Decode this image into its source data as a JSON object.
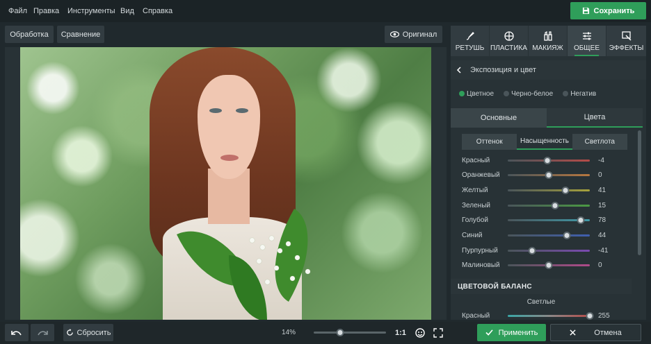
{
  "menu": [
    "Файл",
    "Правка",
    "Инструменты",
    "Вид",
    "Справка"
  ],
  "save_label": "Сохранить",
  "toolbar": {
    "processing": "Обработка",
    "compare": "Сравнение",
    "original": "Оригинал"
  },
  "tabs": [
    {
      "label": "РЕТУШЬ",
      "icon": "brush-icon",
      "active": false
    },
    {
      "label": "ПЛАСТИКА",
      "icon": "crosshair-icon",
      "active": false
    },
    {
      "label": "МАКИЯЖ",
      "icon": "makeup-icon",
      "active": false
    },
    {
      "label": "ОБЩЕЕ",
      "icon": "sliders-icon",
      "active": true
    },
    {
      "label": "ЭФФЕКТЫ",
      "icon": "magic-wand-icon",
      "active": false
    }
  ],
  "section_title": "Экспозиция и цвет",
  "modes": [
    {
      "label": "Цветное",
      "selected": true
    },
    {
      "label": "Черно-белое",
      "selected": false
    },
    {
      "label": "Негатив",
      "selected": false
    }
  ],
  "subtabs": [
    {
      "label": "Основные",
      "active": false
    },
    {
      "label": "Цвета",
      "active": true
    }
  ],
  "segments": [
    {
      "label": "Оттенок",
      "active": false
    },
    {
      "label": "Насыщенность",
      "active": true
    },
    {
      "label": "Светлота",
      "active": false
    }
  ],
  "sliders": [
    {
      "label": "Красный",
      "value": -4,
      "color": "#b54b48"
    },
    {
      "label": "Оранжевый",
      "value": 0,
      "color": "#b7773f"
    },
    {
      "label": "Желтый",
      "value": 41,
      "color": "#a7a23c"
    },
    {
      "label": "Зеленый",
      "value": 15,
      "color": "#4b9a43"
    },
    {
      "label": "Голубой",
      "value": 78,
      "color": "#3f9aa8"
    },
    {
      "label": "Синий",
      "value": 44,
      "color": "#3f5fb0"
    },
    {
      "label": "Пурпурный",
      "value": -41,
      "color": "#7a4ab0"
    },
    {
      "label": "Малиновый",
      "value": 0,
      "color": "#b04a8a"
    }
  ],
  "color_balance": {
    "title": "ЦВЕТОВОЙ БАЛАНС",
    "subtitle": "Светлые",
    "slider": {
      "label": "Красный",
      "value": 255,
      "color": "#b54b48"
    }
  },
  "bottom": {
    "reset": "Сбросить",
    "zoom": "14%",
    "zoom_level": 0.37,
    "one_to_one": "1:1",
    "apply": "Применить",
    "cancel": "Отмена"
  }
}
